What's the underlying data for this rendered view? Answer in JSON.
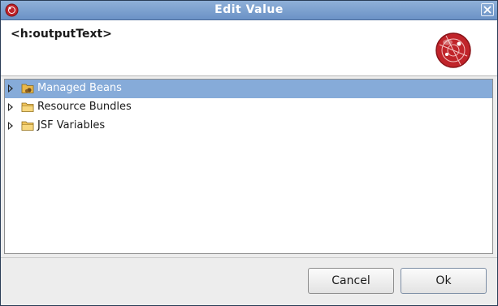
{
  "window": {
    "title": "Edit Value"
  },
  "header": {
    "title": "<h:outputText>"
  },
  "tree": {
    "items": [
      {
        "label": "Managed Beans",
        "selected": true
      },
      {
        "label": "Resource Bundles",
        "selected": false
      },
      {
        "label": "JSF Variables",
        "selected": false
      }
    ]
  },
  "buttons": {
    "cancel": "Cancel",
    "ok": "Ok"
  },
  "colors": {
    "titlebar": "#7ba0d0",
    "selection": "#86abd9",
    "logo": "#c0242a"
  }
}
